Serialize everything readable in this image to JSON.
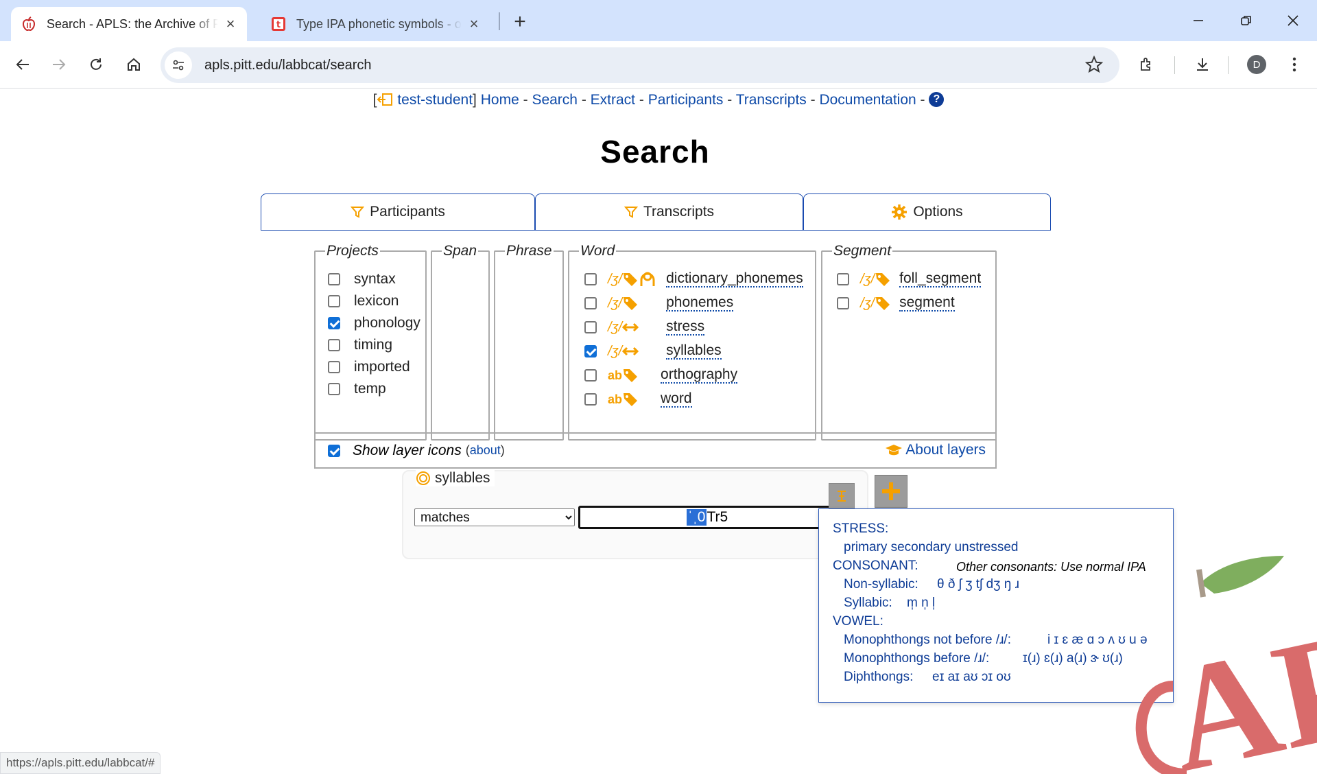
{
  "browser": {
    "tabs": [
      {
        "title": "Search - APLS: the Archive of Pi",
        "active": true,
        "icon": "apple-favicon"
      },
      {
        "title": "Type IPA phonetic symbols - on",
        "active": false,
        "icon": "t-favicon"
      }
    ],
    "url": "apls.pitt.edu/labbcat/search",
    "profile_initial": "D",
    "status_url": "https://apls.pitt.edu/labbcat/#"
  },
  "topnav": {
    "user": "test-student",
    "links": [
      "Home",
      "Search",
      "Extract",
      "Participants",
      "Transcripts",
      "Documentation"
    ],
    "separator": " - ",
    "help": "?"
  },
  "page_title": "Search",
  "filter_tabs": {
    "participants": "Participants",
    "transcripts": "Transcripts",
    "options": "Options"
  },
  "projects": {
    "legend": "Projects",
    "items": [
      {
        "label": "syntax",
        "checked": false
      },
      {
        "label": "lexicon",
        "checked": false
      },
      {
        "label": "phonology",
        "checked": true
      },
      {
        "label": "timing",
        "checked": false
      },
      {
        "label": "imported",
        "checked": false
      },
      {
        "label": "temp",
        "checked": false
      }
    ]
  },
  "span": {
    "legend": "Span"
  },
  "phrase": {
    "legend": "Phrase"
  },
  "word": {
    "legend": "Word",
    "items": [
      {
        "label": "dictionary_phonemes",
        "checked": false,
        "type": "/ʒ/",
        "icons": [
          "tag-icon",
          "person-icon"
        ]
      },
      {
        "label": "phonemes",
        "checked": false,
        "type": "/ʒ/",
        "icons": [
          "tag-icon"
        ]
      },
      {
        "label": "stress",
        "checked": false,
        "type": "/ʒ/",
        "icons": [
          "span-icon"
        ]
      },
      {
        "label": "syllables",
        "checked": true,
        "type": "/ʒ/",
        "icons": [
          "span-icon"
        ]
      },
      {
        "label": "orthography",
        "checked": false,
        "type": "ab",
        "icons": [
          "tag-icon"
        ]
      },
      {
        "label": "word",
        "checked": false,
        "type": "ab",
        "icons": [
          "tag-icon"
        ]
      }
    ]
  },
  "segment": {
    "legend": "Segment",
    "items": [
      {
        "label": "foll_segment",
        "checked": false,
        "type": "/ʒ/",
        "icons": [
          "tag-icon"
        ]
      },
      {
        "label": "segment",
        "checked": false,
        "type": "/ʒ/",
        "icons": [
          "tag-icon"
        ]
      }
    ]
  },
  "show_icons": {
    "label": "Show layer icons",
    "checked": true,
    "about_open": "(",
    "about_link": "about",
    "about_close": ")",
    "about_layers": "About layers"
  },
  "matcher": {
    "layer": "syllables",
    "operator": "matches",
    "pattern_selected": "ˈˌ0",
    "pattern_rest": "Tr5"
  },
  "ipa_help": {
    "stress_heading": "STRESS:",
    "stress_line": "primary secondary unstressed",
    "consonant_heading": "CONSONANT:",
    "consonant_note": "Other consonants: Use normal IPA",
    "nonsyllabic_label": "Non-syllabic:",
    "nonsyllabic_symbols": "θ ð ʃ ʒ tʃ dʒ ŋ ɹ",
    "syllabic_label": "Syllabic:",
    "syllabic_symbols": "m̩ n̩ l̩",
    "vowel_heading": "VOWEL:",
    "mono_not_r_label": "Monophthongs not before /ɹ/:",
    "mono_not_r_symbols": "i ɪ ɛ æ ɑ ɔ ʌ ʊ u ə",
    "mono_r_label": "Monophthongs before /ɹ/:",
    "mono_r_symbols": "ɪ(ɹ) ɛ(ɹ) a(ɹ) ɝ ʊ(ɹ)",
    "diph_label": "Diphthongs:",
    "diph_symbols": "eɪ aɪ aʊ ɔɪ oʊ"
  },
  "logo_text": "APLS",
  "colors": {
    "link": "#0e4aa8",
    "accent": "#f5a000",
    "checkbox": "#0f6fd7",
    "logo_red": "#d96b6b",
    "logo_leaf": "#7fae5e"
  }
}
